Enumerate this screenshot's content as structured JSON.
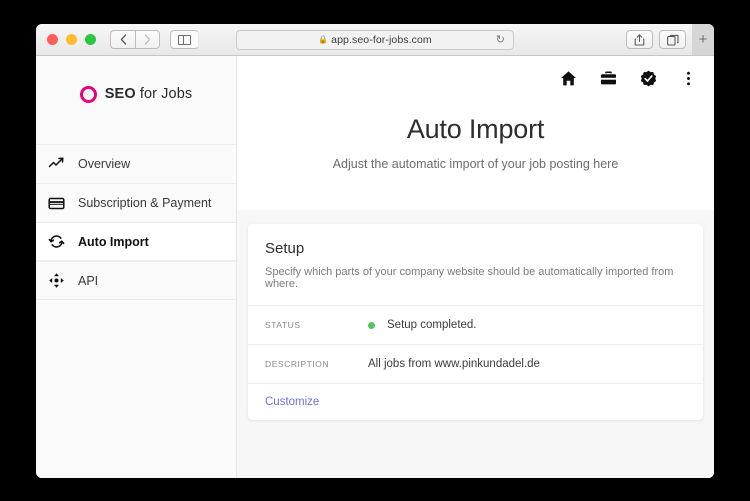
{
  "browser": {
    "url": "app.seo-for-jobs.com",
    "lock_icon": "lock-icon",
    "reload_icon": "reload-icon",
    "back_icon": "chevron-left-icon",
    "forward_icon": "chevron-right-icon",
    "sidebar_toggle_icon": "sidebar-toggle-icon",
    "share_icon": "share-icon",
    "tabs_icon": "tab-overview-icon",
    "new_tab_label": "+",
    "traffic_lights": [
      "close-button",
      "minimize-button",
      "zoom-button"
    ]
  },
  "sidebar": {
    "brand": {
      "mark": "circle-logo-icon",
      "bold": "SEO",
      "rest": " for Jobs"
    },
    "items": [
      {
        "label": "Overview",
        "icon": "trending-line-icon",
        "active": false
      },
      {
        "label": "Subscription & Payment",
        "icon": "credit-card-icon",
        "active": false
      },
      {
        "label": "Auto Import",
        "icon": "sync-arrows-icon",
        "active": true
      },
      {
        "label": "API",
        "icon": "move-arrows-icon",
        "active": false
      }
    ]
  },
  "topbar": {
    "icons": [
      {
        "name": "home-icon"
      },
      {
        "name": "briefcase-icon"
      },
      {
        "name": "verified-badge-icon"
      },
      {
        "name": "overflow-menu-icon"
      }
    ]
  },
  "hero": {
    "title": "Auto Import",
    "subtitle": "Adjust the automatic import of your job posting here"
  },
  "card": {
    "title": "Setup",
    "subtitle": "Specify which parts of your company website should be automatically imported from where.",
    "rows": [
      {
        "label": "STATUS",
        "value": "Setup completed.",
        "has_dot": true
      },
      {
        "label": "DESCRIPTION",
        "value": "All jobs from www.pinkundadel.de",
        "has_dot": false
      }
    ],
    "action_link": "Customize"
  },
  "colors": {
    "brand_magenta": "#e6007e",
    "status_green": "#4fc763",
    "link_blue": "#6772e5",
    "page_bg": "#f7f7f7"
  }
}
